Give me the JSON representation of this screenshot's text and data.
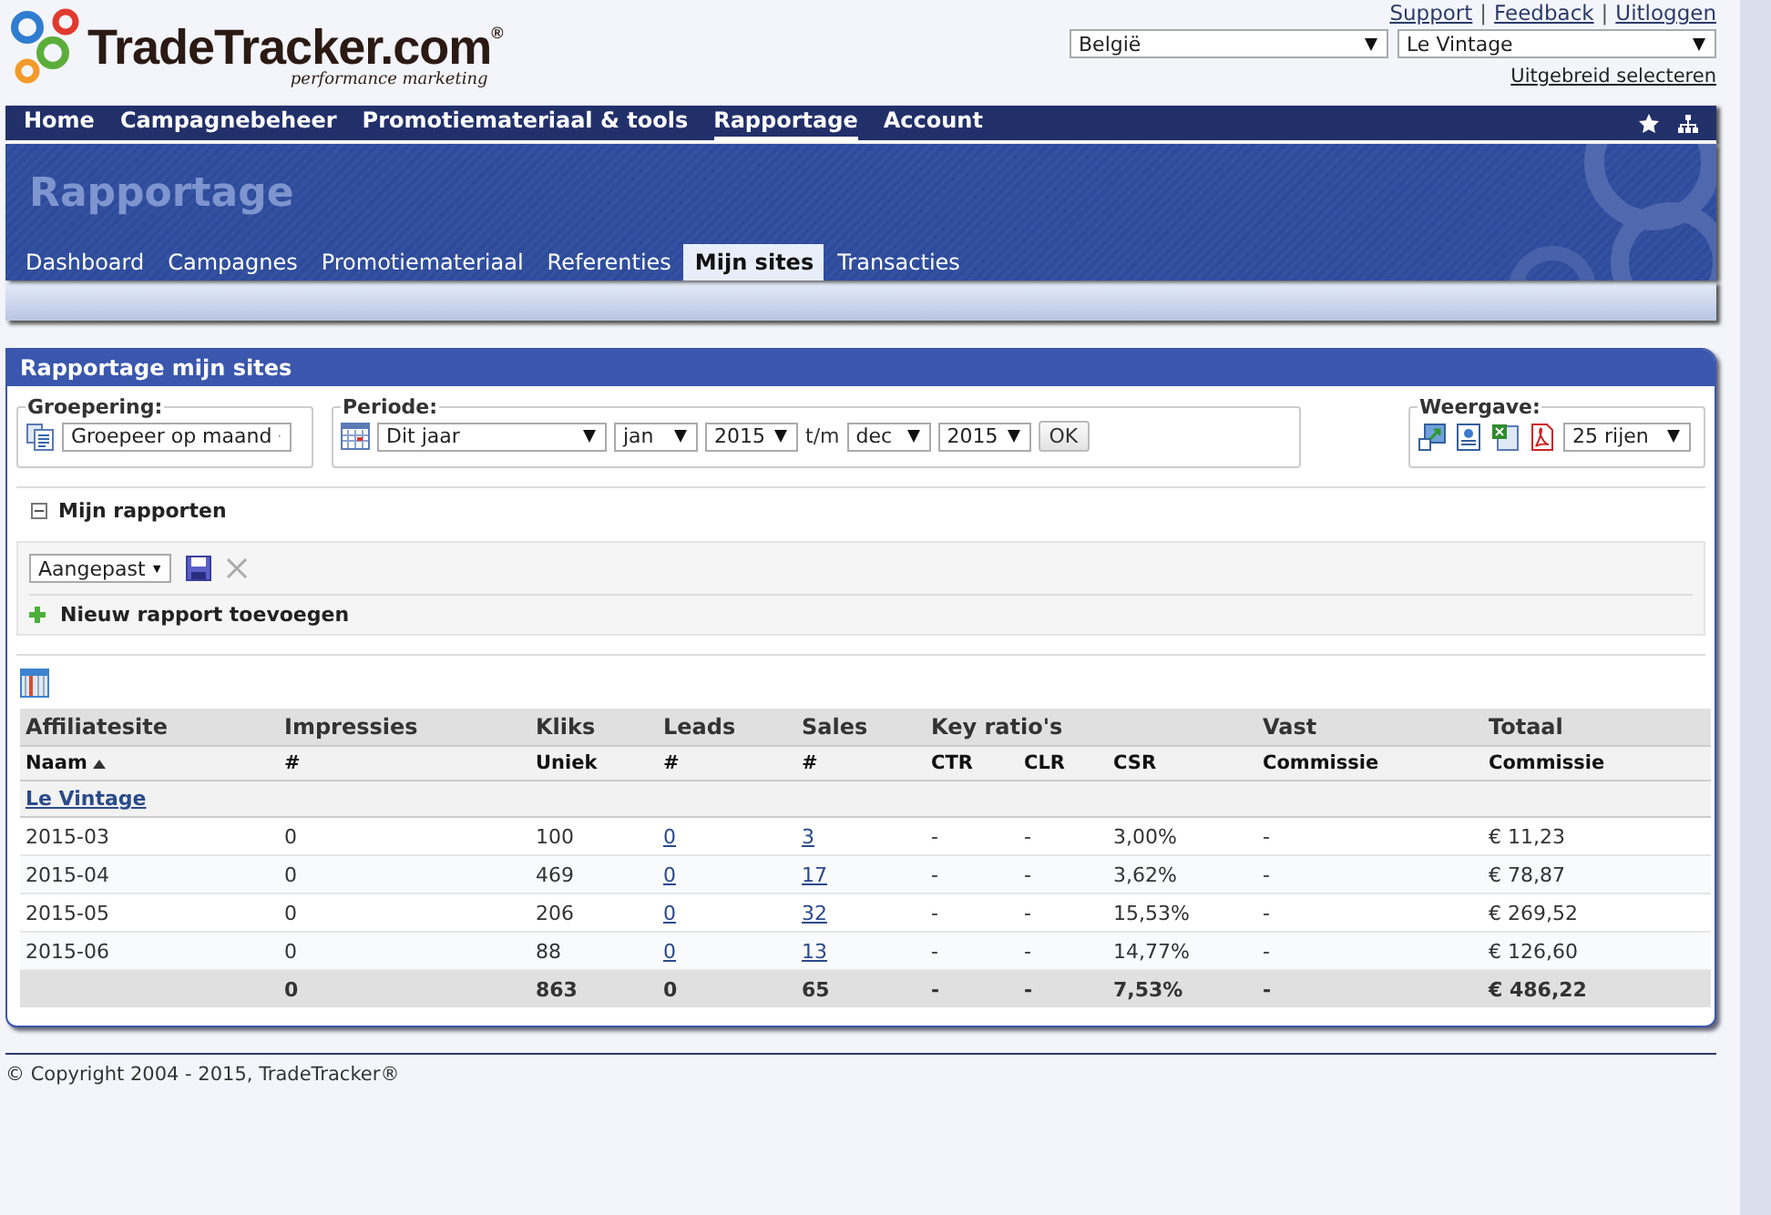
{
  "header": {
    "logo": "TradeTracker.com$^{®}$",
    "tagline": "performance marketing",
    "links": [
      "Support",
      "Feedback",
      "Uitloggen"
    ],
    "separators": [
      "|",
      "|"
    ],
    "selects": [
      "België",
      "Le Vintage"
    ],
    "advanced_link": "Uitgebreid selecteren"
  },
  "nav": {
    "items": [
      {
        "label": "Home",
        "selected": false
      },
      {
        "label": "Campagnebeheer",
        "selected": false
      },
      {
        "label": "Promotiemateriaal & tools",
        "selected": false
      },
      {
        "label": "Rapportage",
        "selected": true
      },
      {
        "label": "Account",
        "selected": false
      }
    ]
  },
  "banner": {
    "title": "Rapportage",
    "tabs": [
      {
        "label": "Dashboard",
        "selected": false
      },
      {
        "label": "Campagnes",
        "selected": false
      },
      {
        "label": "Promotiemateriaal",
        "selected": false
      },
      {
        "label": "Referenties",
        "selected": false
      },
      {
        "label": "Mijn sites",
        "selected": true
      },
      {
        "label": "Transacties",
        "selected": false
      }
    ]
  },
  "panel": {
    "title": "Rapportage mijn sites",
    "grouping": {
      "legend": "Groepering:",
      "select": "Groepeer op maand"
    },
    "period": {
      "legend": "Periode:",
      "preset": "Dit jaar",
      "from_month": "jan",
      "from_year": "2015",
      "separator": "t/m",
      "to_month": "dec",
      "to_year": "2015",
      "button": "OK"
    },
    "view": {
      "legend": "Weergave:",
      "rows_select": "25 rijen"
    },
    "my_reports": {
      "label": "Mijn rapporten",
      "expanded": true,
      "select": "Aangepast",
      "add": "Nieuw rapport toevoegen"
    },
    "table": {
      "groups": [
        {
          "label": "Affiliatesite",
          "columns": [
            {
              "label": "Naam",
              "sorted": true,
              "kind": "text"
            }
          ]
        },
        {
          "label": "Impressies",
          "columns": [
            {
              "label": "#",
              "sorted": false,
              "kind": "text"
            }
          ]
        },
        {
          "label": "Kliks",
          "columns": [
            {
              "label": "Uniek",
              "sorted": false,
              "kind": "text"
            }
          ]
        },
        {
          "label": "Leads",
          "columns": [
            {
              "label": "#",
              "sorted": false,
              "kind": "link"
            }
          ]
        },
        {
          "label": "Sales",
          "columns": [
            {
              "label": "#",
              "sorted": false,
              "kind": "link"
            }
          ]
        },
        {
          "label": "Key ratio's",
          "columns": [
            {
              "label": "CTR",
              "sorted": false,
              "kind": "text"
            },
            {
              "label": "CLR",
              "sorted": false,
              "kind": "text"
            },
            {
              "label": "CSR",
              "sorted": false,
              "kind": "text"
            }
          ]
        },
        {
          "label": "Vast",
          "columns": [
            {
              "label": "Commissie",
              "sorted": false,
              "kind": "text"
            }
          ]
        },
        {
          "label": "Totaal",
          "columns": [
            {
              "label": "Commissie",
              "sorted": false,
              "kind": "text"
            }
          ]
        }
      ],
      "site": "Le Vintage",
      "rows": [
        [
          "2015-03",
          "0",
          "100",
          "0",
          "3",
          "-",
          "-",
          "3,00%",
          "-",
          "€ 11,23"
        ],
        [
          "2015-04",
          "0",
          "469",
          "0",
          "17",
          "-",
          "-",
          "3,62%",
          "-",
          "€ 78,87"
        ],
        [
          "2015-05",
          "0",
          "206",
          "0",
          "32",
          "-",
          "-",
          "15,53%",
          "-",
          "€ 269,52"
        ],
        [
          "2015-06",
          "0",
          "88",
          "0",
          "13",
          "-",
          "-",
          "14,77%",
          "-",
          "€ 126,60"
        ]
      ],
      "total": [
        "0",
        "863",
        "0",
        "65",
        "-",
        "-",
        "7,53%",
        "-",
        "€ 486,22"
      ]
    }
  },
  "footer": {
    "copyright": "© Copyright 2004 - 2015, TradeTracker®"
  }
}
